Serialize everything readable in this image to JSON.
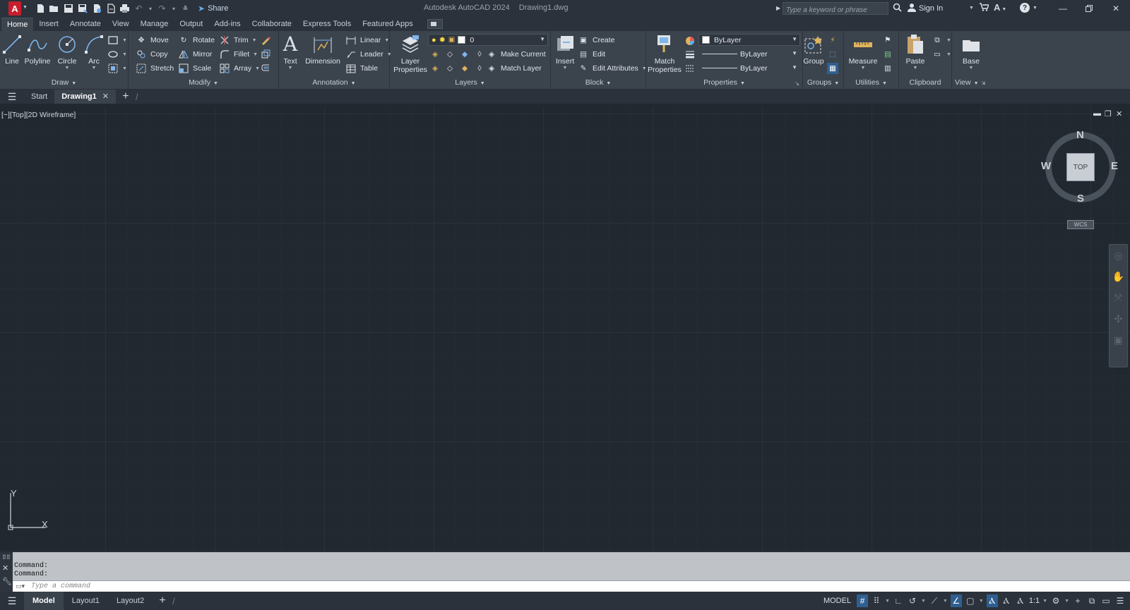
{
  "app": {
    "logo_letter": "A",
    "title": "Autodesk AutoCAD 2024",
    "document": "Drawing1.dwg",
    "share_label": "Share",
    "search_placeholder": "Type a keyword or phrase",
    "signin_label": "Sign In",
    "brand_color": "#c81e2c"
  },
  "ribbon_tabs": [
    "Home",
    "Insert",
    "Annotate",
    "View",
    "Manage",
    "Output",
    "Add-ins",
    "Collaborate",
    "Express Tools",
    "Featured Apps"
  ],
  "active_tab": "Home",
  "ribbon": {
    "draw": {
      "title": "Draw",
      "line": "Line",
      "polyline": "Polyline",
      "circle": "Circle",
      "arc": "Arc"
    },
    "modify": {
      "title": "Modify",
      "move": "Move",
      "rotate": "Rotate",
      "trim": "Trim",
      "copy": "Copy",
      "mirror": "Mirror",
      "fillet": "Fillet",
      "stretch": "Stretch",
      "scale": "Scale",
      "array": "Array"
    },
    "annotation": {
      "title": "Annotation",
      "text": "Text",
      "dimension": "Dimension",
      "linear": "Linear",
      "leader": "Leader",
      "table": "Table"
    },
    "layers": {
      "title": "Layers",
      "layer_properties_1": "Layer",
      "layer_properties_2": "Properties",
      "current_layer": "0",
      "make_current": "Make Current",
      "match_layer": "Match Layer"
    },
    "block": {
      "title": "Block",
      "insert": "Insert",
      "create": "Create",
      "edit": "Edit",
      "edit_attributes": "Edit Attributes"
    },
    "properties": {
      "title": "Properties",
      "match_properties_1": "Match",
      "match_properties_2": "Properties",
      "color": "ByLayer",
      "lineweight": "ByLayer",
      "linetype": "ByLayer"
    },
    "groups": {
      "title": "Groups",
      "group": "Group"
    },
    "utilities": {
      "title": "Utilities",
      "measure": "Measure"
    },
    "clipboard": {
      "title": "Clipboard",
      "paste": "Paste"
    },
    "view": {
      "title": "View",
      "base": "Base"
    }
  },
  "file_tabs": {
    "start": "Start",
    "active": "Drawing1"
  },
  "viewport": {
    "label": "[−][Top][2D Wireframe]",
    "viewcube_face": "TOP",
    "compass_n": "N",
    "compass_s": "S",
    "compass_e": "E",
    "compass_w": "W",
    "wcs": "WCS",
    "ucs_x": "X",
    "ucs_y": "Y"
  },
  "command": {
    "history": [
      "Command:",
      "Command:"
    ],
    "placeholder": "Type a command"
  },
  "layout_tabs": [
    "Model",
    "Layout1",
    "Layout2"
  ],
  "status": {
    "space": "MODEL",
    "scale": "1:1"
  }
}
